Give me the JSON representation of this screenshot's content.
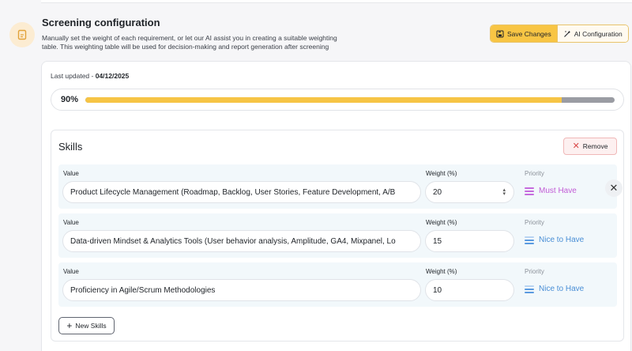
{
  "header": {
    "title": "Screening configuration",
    "description_line1": "Manually set the weight of each requirement, or let our AI assist you in creating a suitable weighting",
    "description_line2": "table. This weighting table will be used for decision-making and report generation after screening"
  },
  "toolbar": {
    "save_label": "Save Changes",
    "ai_label": "AI Configuration"
  },
  "status": {
    "last_updated_label": "Last updated - ",
    "last_updated_date": "04/12/2025"
  },
  "progress": {
    "label": "90%",
    "value": 90,
    "fill_color": "#f6c445",
    "rest_color": "#9a9ca3"
  },
  "skills": {
    "title": "Skills",
    "remove_label": "Remove",
    "new_label": "New Skills",
    "column_value": "Value",
    "column_weight": "Weight (%)",
    "column_priority": "Priority",
    "rows": [
      {
        "value": "Product Lifecycle Management (Roadmap, Backlog, User Stories, Feature Development, A/B",
        "weight": "20",
        "priority": "Must Have"
      },
      {
        "value": "Data-driven Mindset & Analytics Tools (User behavior analysis, Amplitude, GA4, Mixpanel, Lo",
        "weight": "15",
        "priority": "Nice to Have"
      },
      {
        "value": "Proficiency in Agile/Scrum Methodologies",
        "weight": "10",
        "priority": "Nice to Have"
      }
    ]
  },
  "colors": {
    "accent": "#f8c544",
    "must_have": "#c25cd6",
    "nice_to_have": "#4a8fd6",
    "remove": "#d94848"
  }
}
